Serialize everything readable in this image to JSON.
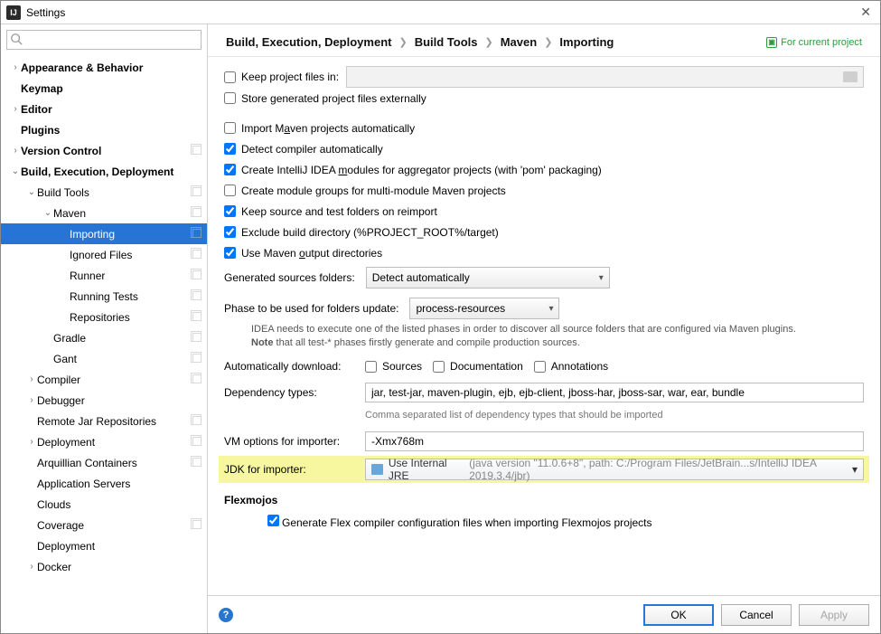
{
  "window": {
    "title": "Settings"
  },
  "search": {
    "placeholder": ""
  },
  "sidebar": {
    "items": [
      {
        "label": "Appearance & Behavior",
        "level": 0,
        "chev": "right",
        "bold": true
      },
      {
        "label": "Keymap",
        "level": 0,
        "chev": "",
        "bold": true
      },
      {
        "label": "Editor",
        "level": 0,
        "chev": "right",
        "bold": true
      },
      {
        "label": "Plugins",
        "level": 0,
        "chev": "",
        "bold": true
      },
      {
        "label": "Version Control",
        "level": 0,
        "chev": "right",
        "bold": true,
        "copy": true
      },
      {
        "label": "Build, Execution, Deployment",
        "level": 0,
        "chev": "down",
        "bold": true
      },
      {
        "label": "Build Tools",
        "level": 1,
        "chev": "down",
        "copy": true
      },
      {
        "label": "Maven",
        "level": 2,
        "chev": "down",
        "copy": true
      },
      {
        "label": "Importing",
        "level": 3,
        "chev": "",
        "selected": true,
        "copy": true
      },
      {
        "label": "Ignored Files",
        "level": 3,
        "chev": "",
        "copy": true
      },
      {
        "label": "Runner",
        "level": 3,
        "chev": "",
        "copy": true
      },
      {
        "label": "Running Tests",
        "level": 3,
        "chev": "",
        "copy": true
      },
      {
        "label": "Repositories",
        "level": 3,
        "chev": "",
        "copy": true
      },
      {
        "label": "Gradle",
        "level": 2,
        "chev": "",
        "copy": true
      },
      {
        "label": "Gant",
        "level": 2,
        "chev": "",
        "copy": true
      },
      {
        "label": "Compiler",
        "level": 1,
        "chev": "right",
        "copy": true
      },
      {
        "label": "Debugger",
        "level": 1,
        "chev": "right"
      },
      {
        "label": "Remote Jar Repositories",
        "level": 1,
        "chev": "",
        "copy": true
      },
      {
        "label": "Deployment",
        "level": 1,
        "chev": "right",
        "copy": true
      },
      {
        "label": "Arquillian Containers",
        "level": 1,
        "chev": "",
        "copy": true
      },
      {
        "label": "Application Servers",
        "level": 1,
        "chev": ""
      },
      {
        "label": "Clouds",
        "level": 1,
        "chev": ""
      },
      {
        "label": "Coverage",
        "level": 1,
        "chev": "",
        "copy": true
      },
      {
        "label": "Deployment",
        "level": 1,
        "chev": ""
      },
      {
        "label": "Docker",
        "level": 1,
        "chev": "right"
      }
    ]
  },
  "breadcrumb": [
    "Build, Execution, Deployment",
    "Build Tools",
    "Maven",
    "Importing"
  ],
  "header_hint": "For current project",
  "checks": {
    "keep_project_files": {
      "label": "Keep project files in:",
      "checked": false
    },
    "store_externally": {
      "label": "Store generated project files externally",
      "checked": false
    },
    "import_auto": {
      "label": "Import Maven projects automatically",
      "checked": false,
      "u": "a"
    },
    "detect_compiler": {
      "label": "Detect compiler automatically",
      "checked": true
    },
    "aggregator": {
      "label": "Create IntelliJ IDEA modules for aggregator projects (with 'pom' packaging)",
      "checked": true,
      "u": "m"
    },
    "module_groups": {
      "label": "Create module groups for multi-module Maven projects",
      "checked": false
    },
    "keep_src": {
      "label": "Keep source and test folders on reimport",
      "checked": true
    },
    "exclude_build": {
      "label": "Exclude build directory (%PROJECT_ROOT%/target)",
      "checked": true
    },
    "use_output": {
      "label": "Use Maven output directories",
      "checked": true,
      "u": "o"
    }
  },
  "generated_sources": {
    "label": "Generated sources folders:",
    "value": "Detect automatically"
  },
  "phase": {
    "label": "Phase to be used for folders update:",
    "value": "process-resources",
    "note1": "IDEA needs to execute one of the listed phases in order to discover all source folders that are configured via Maven plugins.",
    "note2": "Note",
    "note3": " that all test-* phases firstly generate and compile production sources."
  },
  "auto_download": {
    "label": "Automatically download:",
    "sources": "Sources",
    "docs": "Documentation",
    "anno": "Annotations",
    "s": false,
    "d": false,
    "a": false
  },
  "dependency": {
    "label": "Dependency types:",
    "value": "jar, test-jar, maven-plugin, ejb, ejb-client, jboss-har, jboss-sar, war, ear, bundle",
    "hint": "Comma separated list of dependency types that should be imported"
  },
  "vm": {
    "label": "VM options for importer:",
    "value": "-Xmx768m"
  },
  "jdk": {
    "label": "JDK for importer:",
    "value": "Use Internal JRE",
    "detail": "(java version \"11.0.6+8\", path: C:/Program Files/JetBrain...s/IntelliJ IDEA 2019.3.4/jbr)"
  },
  "flexmojos": {
    "title": "Flexmojos",
    "label": "Generate Flex compiler configuration files when importing Flexmojos projects",
    "checked": true
  },
  "buttons": {
    "ok": "OK",
    "cancel": "Cancel",
    "apply": "Apply"
  }
}
